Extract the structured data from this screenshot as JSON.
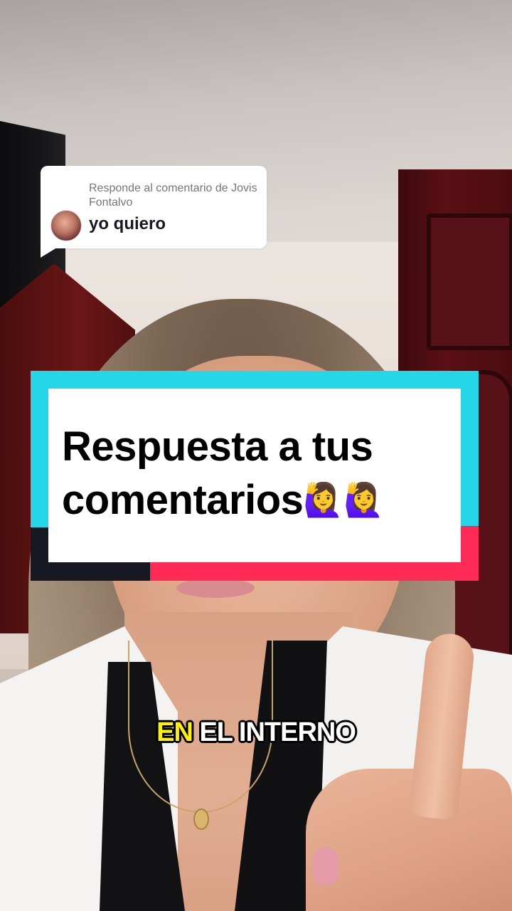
{
  "reply_sticker": {
    "header": "Responde al comentario de Jovis Fontalvo",
    "comment": "yo quiero"
  },
  "title_card": {
    "line1": "Respuesta a tus",
    "line2": "comentarios",
    "emoji": "🙋‍♀️🙋‍♀️",
    "colors": {
      "cyan": "#25d6e9",
      "red": "#fe2a55",
      "dark": "#161823"
    }
  },
  "subtitle": {
    "highlight": "EN",
    "rest": "EL INTERNO",
    "highlight_color": "#fff200"
  }
}
